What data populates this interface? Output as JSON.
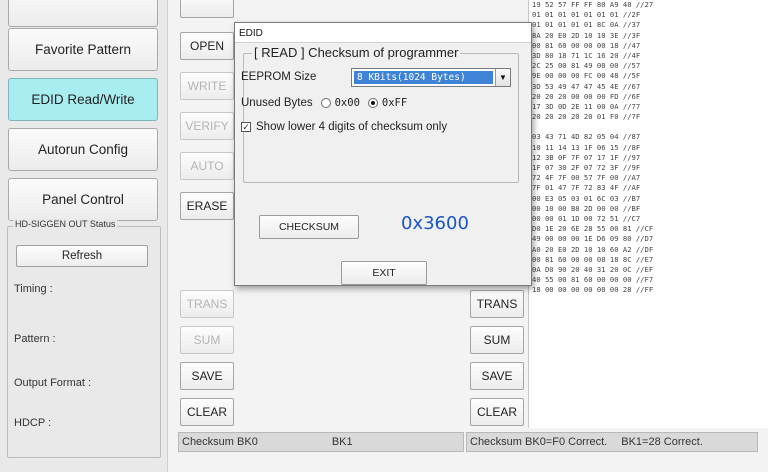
{
  "sidebar": {
    "buttons": [
      {
        "label": "Favorite Pattern",
        "active": false
      },
      {
        "label": "EDID Read/Write",
        "active": true
      },
      {
        "label": "Autorun Config",
        "active": false
      },
      {
        "label": "Panel Control",
        "active": false
      }
    ],
    "status_group": {
      "title": "HD-SIGGEN OUT Status",
      "refresh_label": "Refresh",
      "fields": [
        "Timing :",
        "Pattern :",
        "Output Format :",
        "HDCP :"
      ]
    }
  },
  "edid_panel": {
    "left_buttons": [
      "OPEN",
      "WRITE",
      "VERIFY",
      "AUTO",
      "ERASE",
      "TRANS",
      "SUM",
      "SAVE",
      "CLEAR"
    ],
    "right_buttons": [
      "TRANS",
      "SUM",
      "SAVE",
      "CLEAR"
    ],
    "status_left": "Checksum BK0",
    "status_left_bk1": "BK1",
    "status_right": "Checksum BK0=F0 Correct.",
    "status_right_bk1": "BK1=28 Correct."
  },
  "hex_lines": [
    "19 52 57 FF FF 80 A9 40 //27",
    "01 01 01 01 01 01 01 //2F",
    "01 01 01 01 01 8C 0A //37",
    "8A 20 E0 2D 10 10 3E //3F",
    "00 81 60 00 00 00 18 //47",
    "3D 80 18 71 1C 16 20 //4F",
    "2C 25 00 81 49 00 00 //57",
    "9E 00 00 00 FC 00 48 //5F",
    "3D 53 49 47 47 45 4E //67",
    "20 20 20 00 00 00 FD //6F",
    "17 3D 0D 2E 11 00 0A //77",
    "20 20 20 20 20 01 F0 //7F",
    "",
    "03 43 71 4D 82 05 04 //87",
    "10 11 14 13 1F 06 15 //8F",
    "12 3B 0F 7F 07 17 1F //97",
    "1F 07 30 2F 07 72 3F //9F",
    "72 4F 7F 00 57 7F 00 //A7",
    "7F 01 47 7F 72 83 4F //AF",
    "00 E3 05 03 01 6C 03 //B7",
    "00 10 00 B8 2D 00 00 //BF",
    "00 00 01 1D 00 72 51 //C7",
    "D0 1E 20 6E 28 55 00 81 //CF",
    "49 00 00 00 1E D6 09 80 //D7",
    "A0 20 E0 2D 10 10 60 A2 //DF",
    "00 81 60 00 00 08 18 8C //E7",
    "0A D0 90 20 40 31 20 0C //EF",
    "40 55 00 81 60 00 00 00 //F7",
    "18 00 00 00 00 00 00 28 //FF"
  ],
  "dialog": {
    "title": "EDID",
    "group_title": "[ READ ] Checksum of programmer",
    "eeprom_label": "EEPROM Size",
    "eeprom_value": "8 KBits(1024 Bytes)",
    "unused_label": "Unused Bytes",
    "unused_opt1": "0x00",
    "unused_opt2": "0xFF",
    "unused_selected": "0xFF",
    "show_lower_label": "Show lower 4 digits of checksum only",
    "show_lower_checked": true,
    "checksum_button": "CHECKSUM",
    "checksum_value": "0x3600",
    "exit_button": "EXIT"
  },
  "colors": {
    "active_nav": "#a8eef1",
    "selection_blue": "#3f83d6",
    "checksum_text": "#1a55c6"
  },
  "icons": {
    "dropdown": "chevron-down-icon",
    "checkbox_mark": "checkmark-icon"
  }
}
